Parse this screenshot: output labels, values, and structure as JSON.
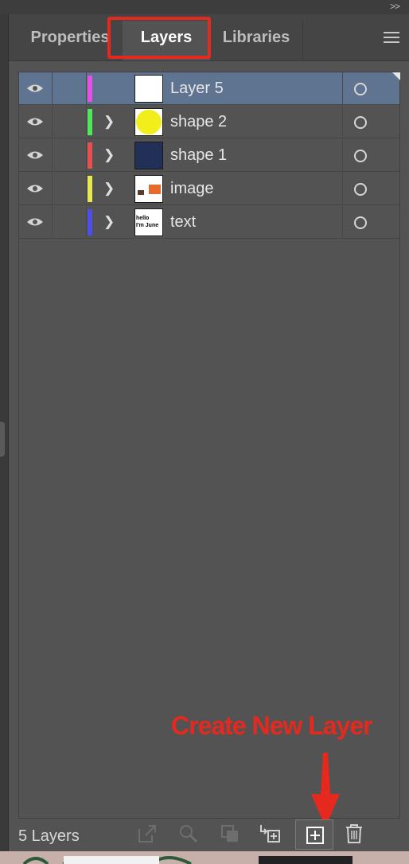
{
  "panel": {
    "tabs": [
      {
        "label": "Properties",
        "active": false
      },
      {
        "label": "Layers",
        "active": true
      },
      {
        "label": "Libraries",
        "active": false
      }
    ]
  },
  "layers": [
    {
      "name": "Layer 5",
      "color": "#e84fe8",
      "selected": true,
      "expandable": false,
      "thumb": "blank",
      "visible": true
    },
    {
      "name": "shape 2",
      "color": "#4fe85a",
      "selected": false,
      "expandable": true,
      "thumb": "yellow-circle",
      "visible": true
    },
    {
      "name": "shape 1",
      "color": "#e84f4f",
      "selected": false,
      "expandable": true,
      "thumb": "navy-rect",
      "visible": true
    },
    {
      "name": "image",
      "color": "#e8e84f",
      "selected": false,
      "expandable": true,
      "thumb": "image",
      "visible": true
    },
    {
      "name": "text",
      "color": "#4f4fe8",
      "selected": false,
      "expandable": true,
      "thumb": "text",
      "visible": true
    }
  ],
  "thumb_text": {
    "line1": "hello",
    "line2": "I'm June"
  },
  "annotation": {
    "label": "Create New Layer",
    "color": "#e5291e"
  },
  "footer": {
    "count_label": "5 Layers",
    "icons": [
      "export-icon",
      "locate-object-icon",
      "make-clipping-mask-icon",
      "move-to-layer-icon",
      "create-new-layer-icon",
      "delete-icon"
    ]
  }
}
